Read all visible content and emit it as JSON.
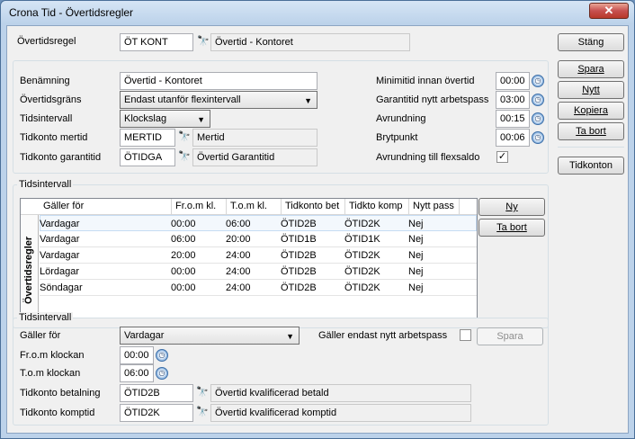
{
  "window": {
    "title": "Crona Tid - Övertidsregler",
    "close": "✕"
  },
  "header": {
    "rule_label": "Övertidsregel",
    "rule_code": "ÖT KONT",
    "rule_name": "Övertid - Kontoret",
    "close_button": "Stäng"
  },
  "side_buttons": {
    "save": "Spara",
    "new": "Nytt",
    "copy": "Kopiera",
    "delete": "Ta bort",
    "accounts": "Tidkonton"
  },
  "general": {
    "name_label": "Benämning",
    "name_value": "Övertid - Kontoret",
    "limit_label": "Övertidsgräns",
    "limit_value": "Endast utanför flexintervall",
    "interval_label": "Tidsintervall",
    "interval_value": "Klockslag",
    "acc_more_label": "Tidkonto mertid",
    "acc_more_code": "MERTID",
    "acc_more_name": "Mertid",
    "acc_guar_label": "Tidkonto garantitid",
    "acc_guar_code": "ÖTIDGA",
    "acc_guar_name": "Övertid Garantitid",
    "min_label": "Minimitid innan övertid",
    "min_value": "00:00",
    "guar_label": "Garantitid nytt arbetspass",
    "guar_value": "03:00",
    "round_label": "Avrundning",
    "round_value": "00:15",
    "break_label": "Brytpunkt",
    "break_value": "00:06",
    "flex_label": "Avrundning till flexsaldo",
    "flex_checked": "✓"
  },
  "intervals": {
    "title": "Tidsintervall",
    "side_label": "Övertidsregler",
    "columns": [
      "Gäller för",
      "Fr.o.m kl.",
      "T.o.m kl.",
      "Tidkonto bet",
      "Tidkto komp",
      "Nytt pass"
    ],
    "rows": [
      [
        "Vardagar",
        "00:00",
        "06:00",
        "ÖTID2B",
        "ÖTID2K",
        "Nej"
      ],
      [
        "Vardagar",
        "06:00",
        "20:00",
        "ÖTID1B",
        "ÖTID1K",
        "Nej"
      ],
      [
        "Vardagar",
        "20:00",
        "24:00",
        "ÖTID2B",
        "ÖTID2K",
        "Nej"
      ],
      [
        "Lördagar",
        "00:00",
        "24:00",
        "ÖTID2B",
        "ÖTID2K",
        "Nej"
      ],
      [
        "Söndagar",
        "00:00",
        "24:00",
        "ÖTID2B",
        "ÖTID2K",
        "Nej"
      ]
    ],
    "new_button": "Ny",
    "delete_button": "Ta bort"
  },
  "detail": {
    "title": "Tidsintervall",
    "applies_label": "Gäller för",
    "applies_value": "Vardagar",
    "new_only_label": "Gäller endast nytt arbetspass",
    "save_button": "Spara",
    "from_label": "Fr.o.m klockan",
    "from_value": "00:00",
    "to_label": "T.o.m klockan",
    "to_value": "06:00",
    "pay_label": "Tidkonto betalning",
    "pay_code": "ÖTID2B",
    "pay_name": "Övertid kvalificerad betald",
    "comp_label": "Tidkonto komptid",
    "comp_code": "ÖTID2K",
    "comp_name": "Övertid kvalificerad komptid"
  }
}
